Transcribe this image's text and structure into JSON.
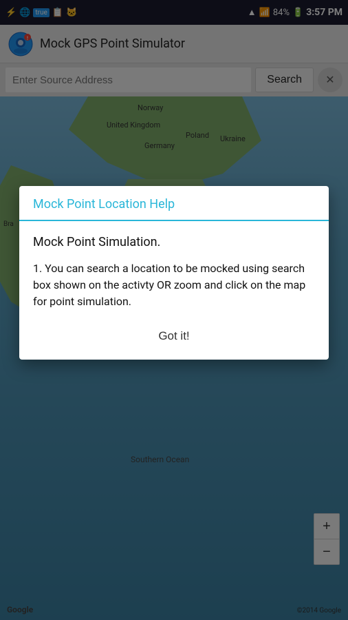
{
  "statusBar": {
    "time": "3:57 PM",
    "battery": "84%",
    "icons": {
      "usb": "⚡",
      "wifi": "▲",
      "signal": "▌▌▌",
      "battery": "🔋"
    }
  },
  "appBar": {
    "title": "Mock GPS Point Simulator"
  },
  "searchBar": {
    "placeholder": "Enter Source Address",
    "searchButton": "Search",
    "clearButton": "✕"
  },
  "map": {
    "labels": {
      "norway": "Norway",
      "unitedKingdom": "United Kingdom",
      "poland": "Poland",
      "germany": "Germany",
      "ukraine": "Ukraine",
      "brazil": "Bra",
      "southernOcean": "Southern Ocean",
      "google": "Google",
      "copyright": "©2014 Google"
    },
    "zoomIn": "+",
    "zoomOut": "−"
  },
  "dialog": {
    "title": "Mock Point Location Help",
    "heading": "Mock Point Simulation.",
    "body": "1. You can search a location to be mocked using search box shown on the activty OR zoom and click on the map for point simulation.",
    "actionButton": "Got it!"
  }
}
